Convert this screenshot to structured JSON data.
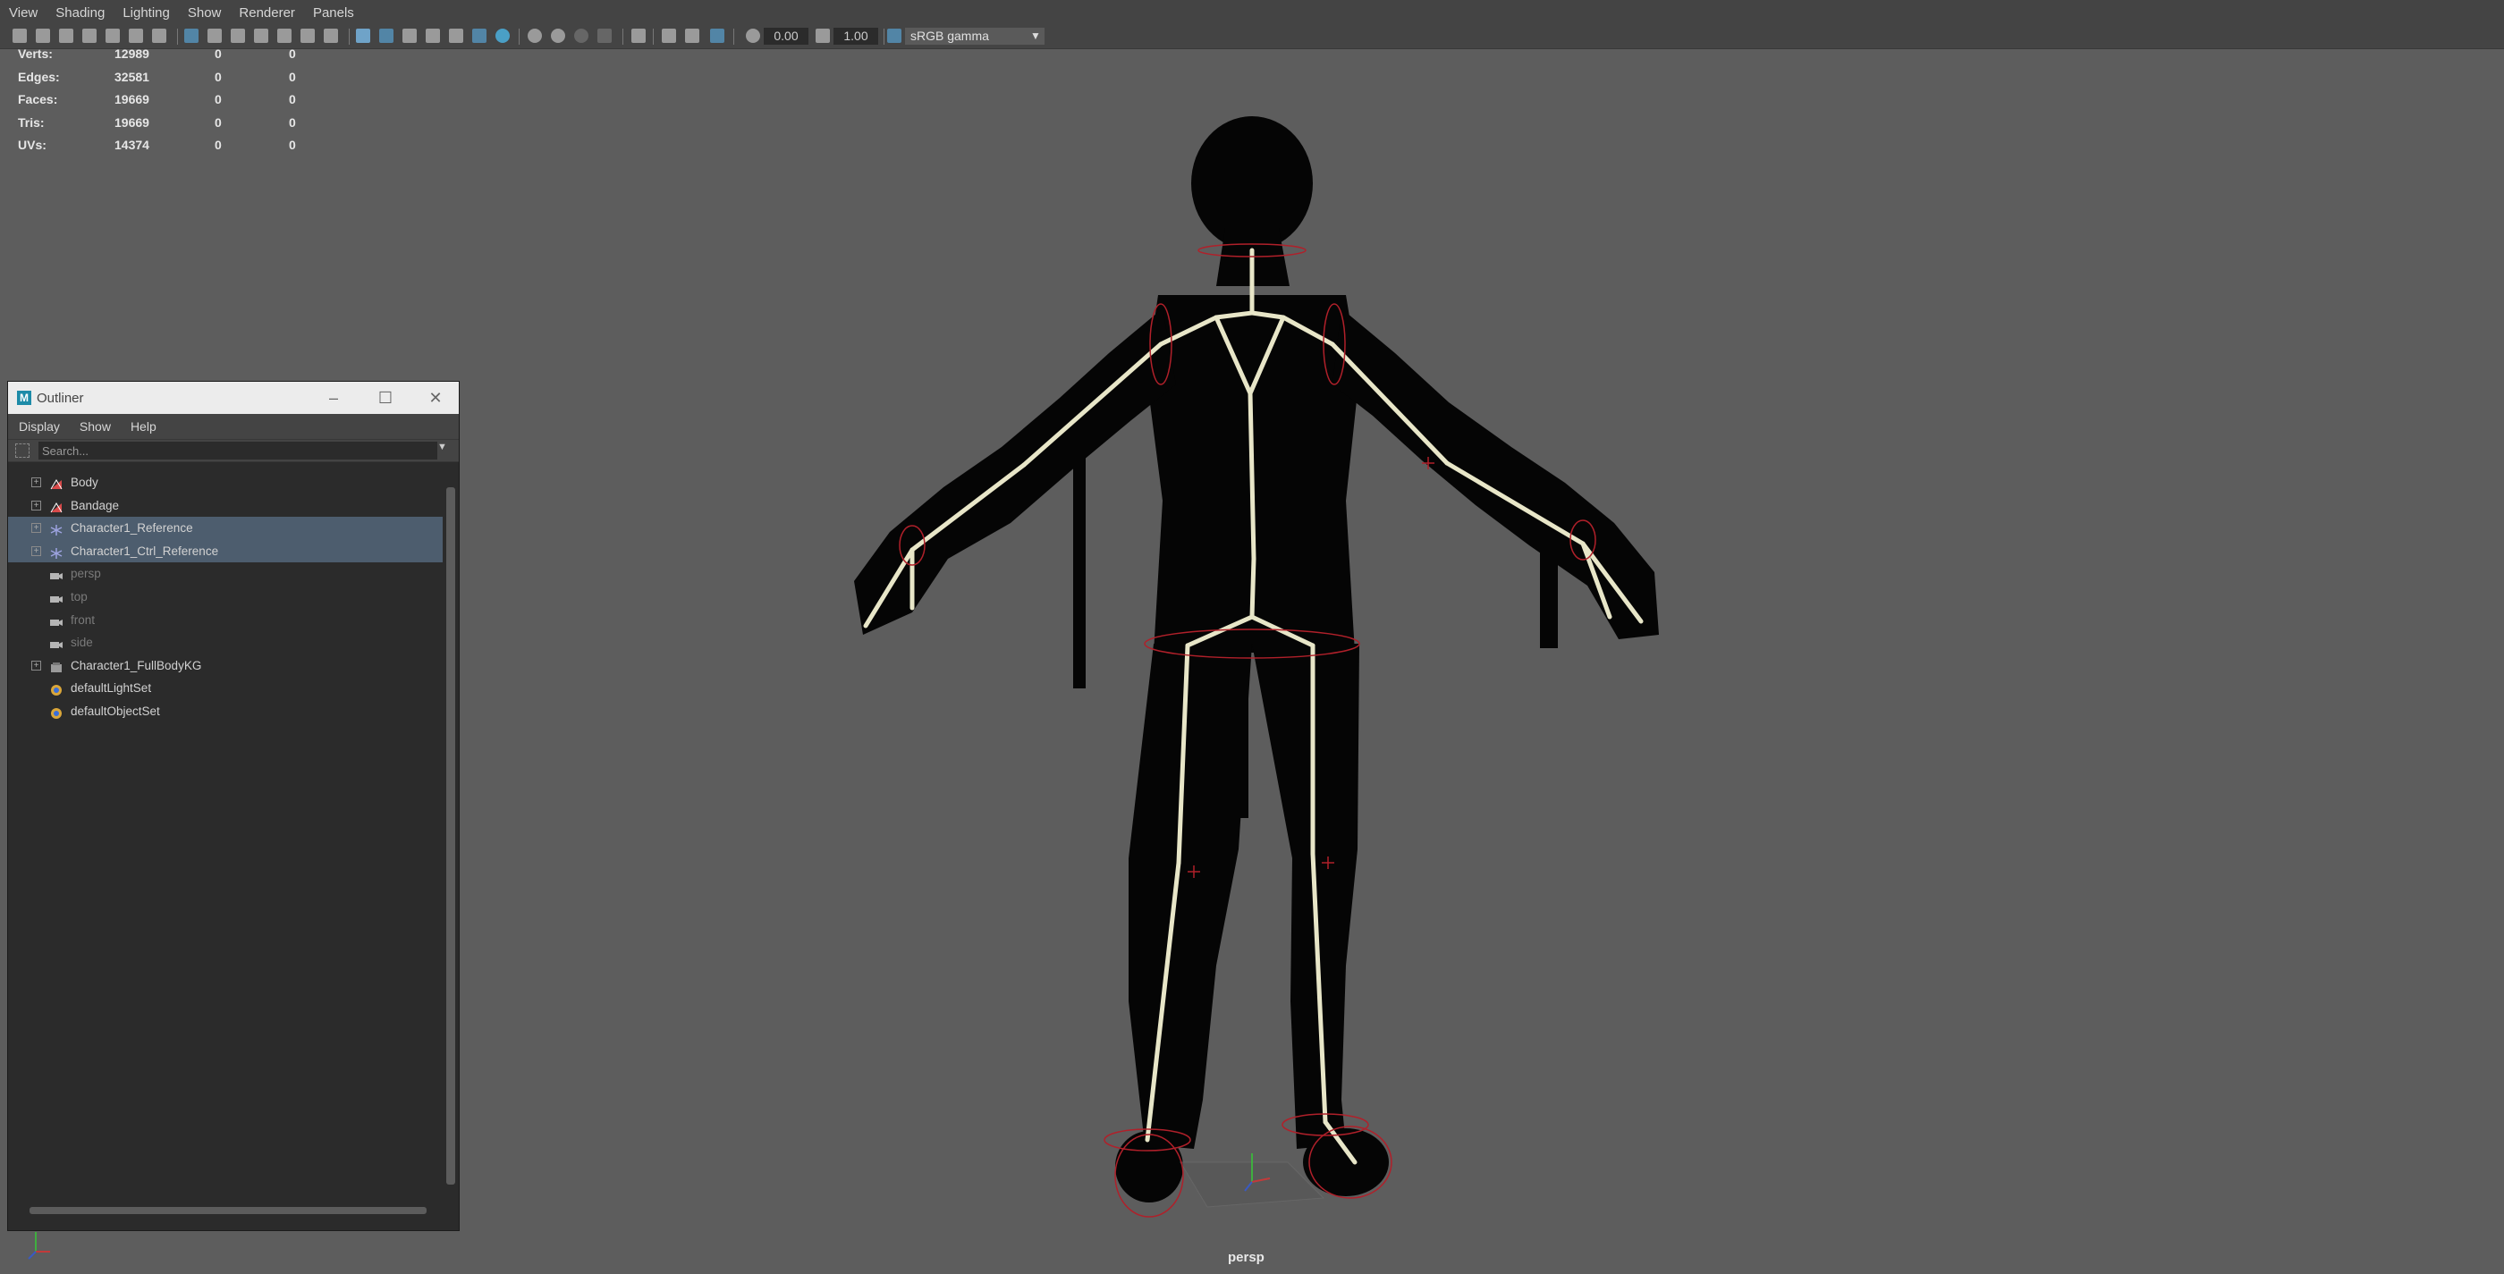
{
  "menu": [
    "View",
    "Shading",
    "Lighting",
    "Show",
    "Renderer",
    "Panels"
  ],
  "toolbar": {
    "exposure_value": "0.00",
    "gamma_value": "1.00",
    "color_space": "sRGB gamma"
  },
  "hud": {
    "rows": [
      {
        "label": "Verts:",
        "total": "12989",
        "selected": "0",
        "component": "0"
      },
      {
        "label": "Edges:",
        "total": "32581",
        "selected": "0",
        "component": "0"
      },
      {
        "label": "Faces:",
        "total": "19669",
        "selected": "0",
        "component": "0"
      },
      {
        "label": "Tris:",
        "total": "19669",
        "selected": "0",
        "component": "0"
      },
      {
        "label": "UVs:",
        "total": "14374",
        "selected": "0",
        "component": "0"
      }
    ]
  },
  "viewport": {
    "camera_label": "persp"
  },
  "outliner": {
    "title": "Outliner",
    "logo": "M",
    "menu": [
      "Display",
      "Show",
      "Help"
    ],
    "search_placeholder": "Search...",
    "items": [
      {
        "label": "Body",
        "icon": "mesh-icon",
        "expandable": true,
        "selected": false,
        "dim": false
      },
      {
        "label": "Bandage",
        "icon": "mesh-icon",
        "expandable": true,
        "selected": false,
        "dim": false
      },
      {
        "label": "Character1_Reference",
        "icon": "joint-icon",
        "expandable": true,
        "selected": true,
        "dim": false
      },
      {
        "label": "Character1_Ctrl_Reference",
        "icon": "joint-icon",
        "expandable": true,
        "selected": true,
        "dim": false
      },
      {
        "label": "persp",
        "icon": "camera-icon",
        "expandable": false,
        "selected": false,
        "dim": true
      },
      {
        "label": "top",
        "icon": "camera-icon",
        "expandable": false,
        "selected": false,
        "dim": true
      },
      {
        "label": "front",
        "icon": "camera-icon",
        "expandable": false,
        "selected": false,
        "dim": true
      },
      {
        "label": "side",
        "icon": "camera-icon",
        "expandable": false,
        "selected": false,
        "dim": true
      },
      {
        "label": "Character1_FullBodyKG",
        "icon": "group-icon",
        "expandable": true,
        "selected": false,
        "dim": false
      },
      {
        "label": "defaultLightSet",
        "icon": "set-icon",
        "expandable": false,
        "selected": false,
        "dim": false
      },
      {
        "label": "defaultObjectSet",
        "icon": "set-icon",
        "expandable": false,
        "selected": false,
        "dim": false
      }
    ]
  },
  "colors": {
    "viewport_bg": "#5d5d5d",
    "selection": "#4d5d6e",
    "bone": "#e8e6c8",
    "control": "#b0202a"
  }
}
